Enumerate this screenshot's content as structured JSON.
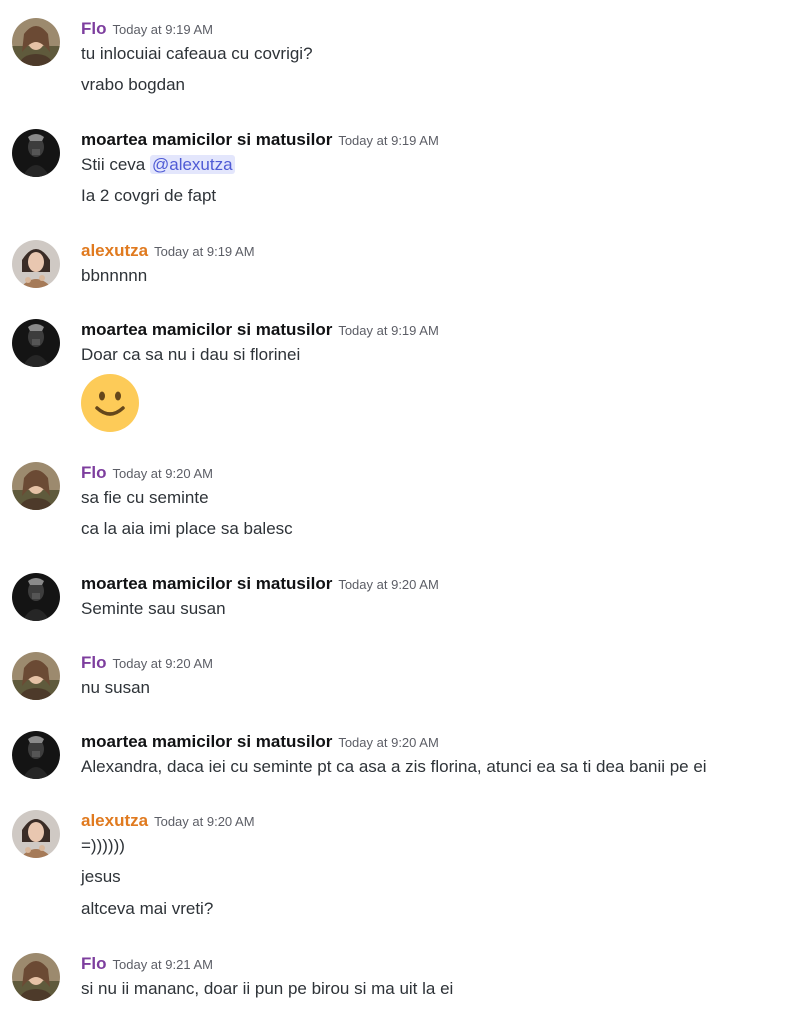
{
  "colors": {
    "flo": "#7d3e9e",
    "alexutza": "#e07a1f",
    "moartea": "#111214",
    "mention_bg": "#e3e6fc",
    "mention_fg": "#4f5bd5",
    "timestamp": "#5c5e66",
    "text": "#2e3338"
  },
  "messages": [
    {
      "user": "Flo",
      "time": "Today at 9:19 AM",
      "lines": [
        "tu inlocuiai cafeaua cu covrigi?",
        "vrabo bogdan"
      ]
    },
    {
      "user": "moartea mamicilor si matusilor",
      "time": "Today at 9:19 AM",
      "lines": [
        "Stii ceva ",
        "Ia 2 covgri de fapt"
      ],
      "mention": "@alexutza"
    },
    {
      "user": "alexutza",
      "time": "Today at 9:19 AM",
      "lines": [
        "bbnnnnn"
      ]
    },
    {
      "user": "moartea mamicilor si matusilor",
      "time": "Today at 9:19 AM",
      "lines": [
        "Doar ca sa nu i dau si florinei"
      ],
      "emoji": "slightly-smiling-face-icon"
    },
    {
      "user": "Flo",
      "time": "Today at 9:20 AM",
      "lines": [
        "sa fie cu seminte",
        "ca la aia imi place sa balesc"
      ]
    },
    {
      "user": "moartea mamicilor si matusilor",
      "time": "Today at 9:20 AM",
      "lines": [
        "Seminte sau susan"
      ]
    },
    {
      "user": "Flo",
      "time": "Today at 9:20 AM",
      "lines": [
        "nu susan"
      ]
    },
    {
      "user": "moartea mamicilor si matusilor",
      "time": "Today at 9:20 AM",
      "lines": [
        "Alexandra, daca iei cu seminte pt ca asa a zis florina, atunci ea sa ti dea banii pe ei"
      ]
    },
    {
      "user": "alexutza",
      "time": "Today at 9:20 AM",
      "lines": [
        "=))))))",
        "jesus",
        "altceva mai vreti?"
      ]
    },
    {
      "user": "Flo",
      "time": "Today at 9:21 AM",
      "lines": [
        "si nu ii mananc, doar ii pun pe birou si ma uit la ei"
      ]
    }
  ]
}
